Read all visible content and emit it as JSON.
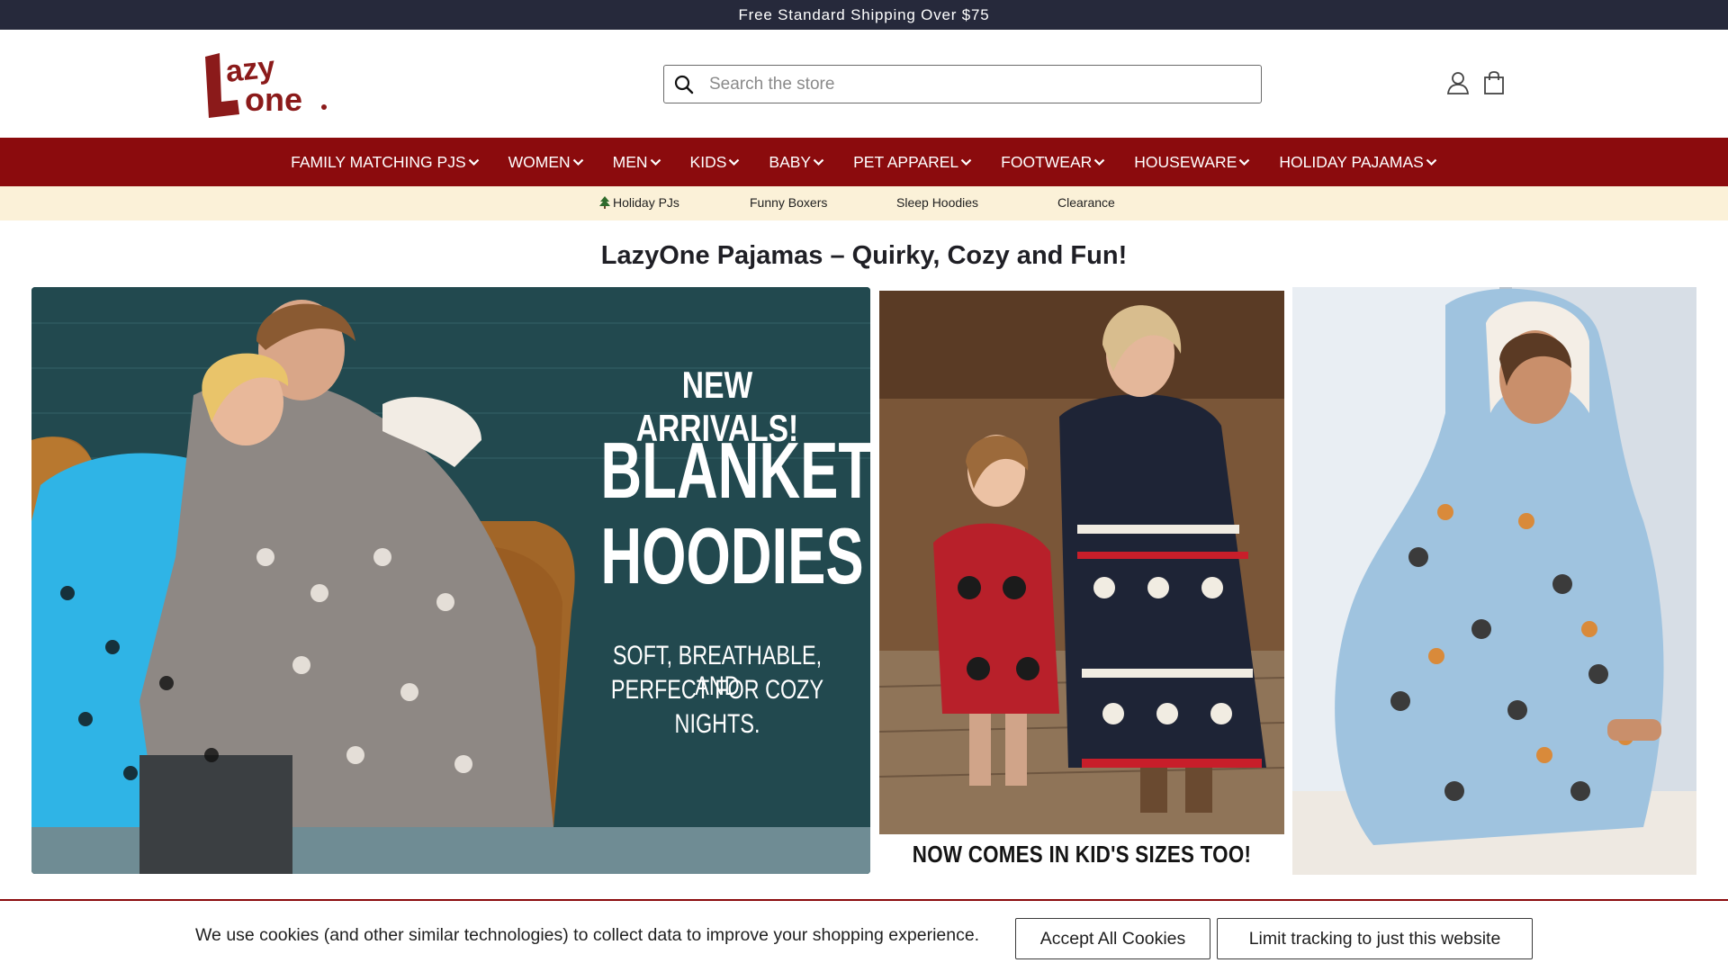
{
  "announcement": "Free Standard Shipping Over $75",
  "search": {
    "placeholder": "Search the store"
  },
  "nav": [
    {
      "label": "FAMILY MATCHING PJS"
    },
    {
      "label": "WOMEN"
    },
    {
      "label": "MEN"
    },
    {
      "label": "KIDS"
    },
    {
      "label": "BABY"
    },
    {
      "label": "PET APPAREL"
    },
    {
      "label": "FOOTWEAR"
    },
    {
      "label": "HOUSEWARE"
    },
    {
      "label": "HOLIDAY PAJAMAS"
    }
  ],
  "subnav": [
    {
      "icon": "tree-icon",
      "label": "Holiday PJs"
    },
    {
      "label": "Funny Boxers"
    },
    {
      "label": "Sleep Hoodies"
    },
    {
      "label": "Clearance"
    }
  ],
  "headline": "LazyOne Pajamas – Quirky, Cozy and Fun!",
  "hero1": {
    "line1": "NEW ARRIVALS!",
    "line2": "BLANKET",
    "line3": "HOODIES",
    "line4": "SOFT, BREATHABLE, AND",
    "line5": "PERFECT FOR COZY",
    "line6": "NIGHTS."
  },
  "hero2": {
    "caption": "NOW COMES IN KID'S SIZES TOO!"
  },
  "cookie": {
    "text": "We use cookies (and other similar technologies) to collect data to improve your shopping experience.",
    "accept": "Accept All Cookies",
    "limit": "Limit tracking to just this website"
  },
  "colors": {
    "brand_red": "#8b0b0d",
    "announce_bg": "#26293b",
    "subnav_bg": "#fbf1d8"
  }
}
